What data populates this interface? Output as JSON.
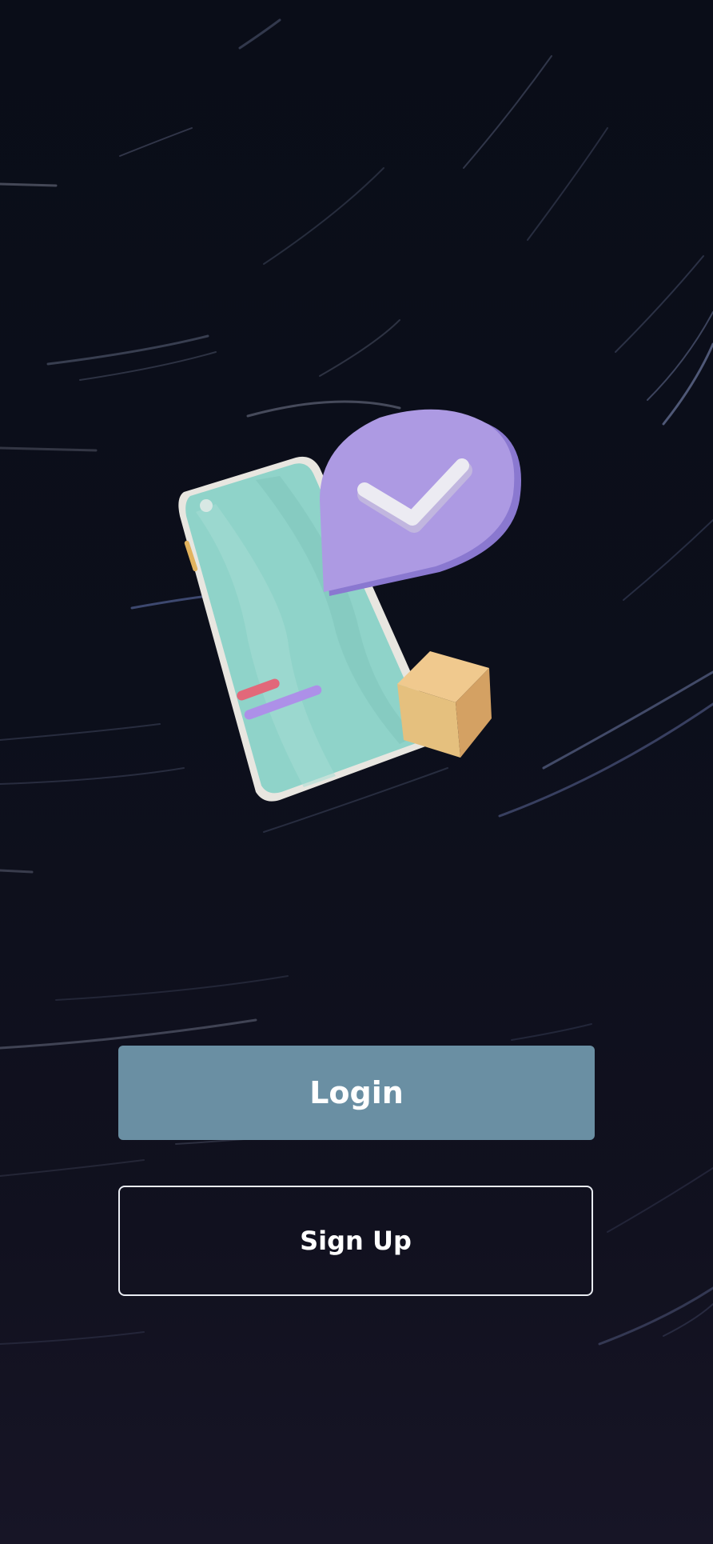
{
  "actions": {
    "login_label": "Login",
    "signup_label": "Sign Up"
  },
  "illustration": {
    "icons": [
      "phone-icon",
      "checkmark-bubble-icon",
      "box-icon"
    ]
  },
  "colors": {
    "background": "#0b0d17",
    "login_button": "#6a8fa3",
    "signup_border": "#e9ecf2",
    "phone": "#8fd0c8",
    "bubble": "#a996e0",
    "box": "#e5b97a"
  }
}
